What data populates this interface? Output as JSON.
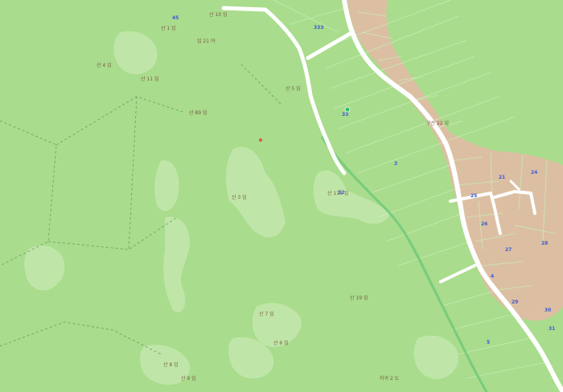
{
  "map": {
    "colors": {
      "forest": "#a9dc8c",
      "forest_light": "#bfe6a8",
      "urban": "#dcbfa3",
      "road": "#ffffff",
      "stream": "#6fc97a",
      "parcel_line": "#c7ebb6",
      "label_text": "#7a5a46",
      "parcel_number": "#3b5bd4"
    },
    "labels": [
      "산 1 임",
      "임 21 야",
      "산 4 임",
      "산 5 임",
      "구산 22 임",
      "산 89 임",
      "산 3 임",
      "산 115 임",
      "산 19 임",
      "하귀 2 도",
      "산 7 임",
      "산 6 임",
      "산 8 임",
      "산 9 임",
      "산 10 임",
      "산 11 임"
    ],
    "parcel_numbers": [
      "45",
      "333",
      "3",
      "4",
      "5",
      "21",
      "24",
      "25",
      "26",
      "27",
      "28",
      "29",
      "30",
      "31",
      "32",
      "33"
    ],
    "icons": [
      "location-pin-icon",
      "point-marker-icon"
    ]
  }
}
